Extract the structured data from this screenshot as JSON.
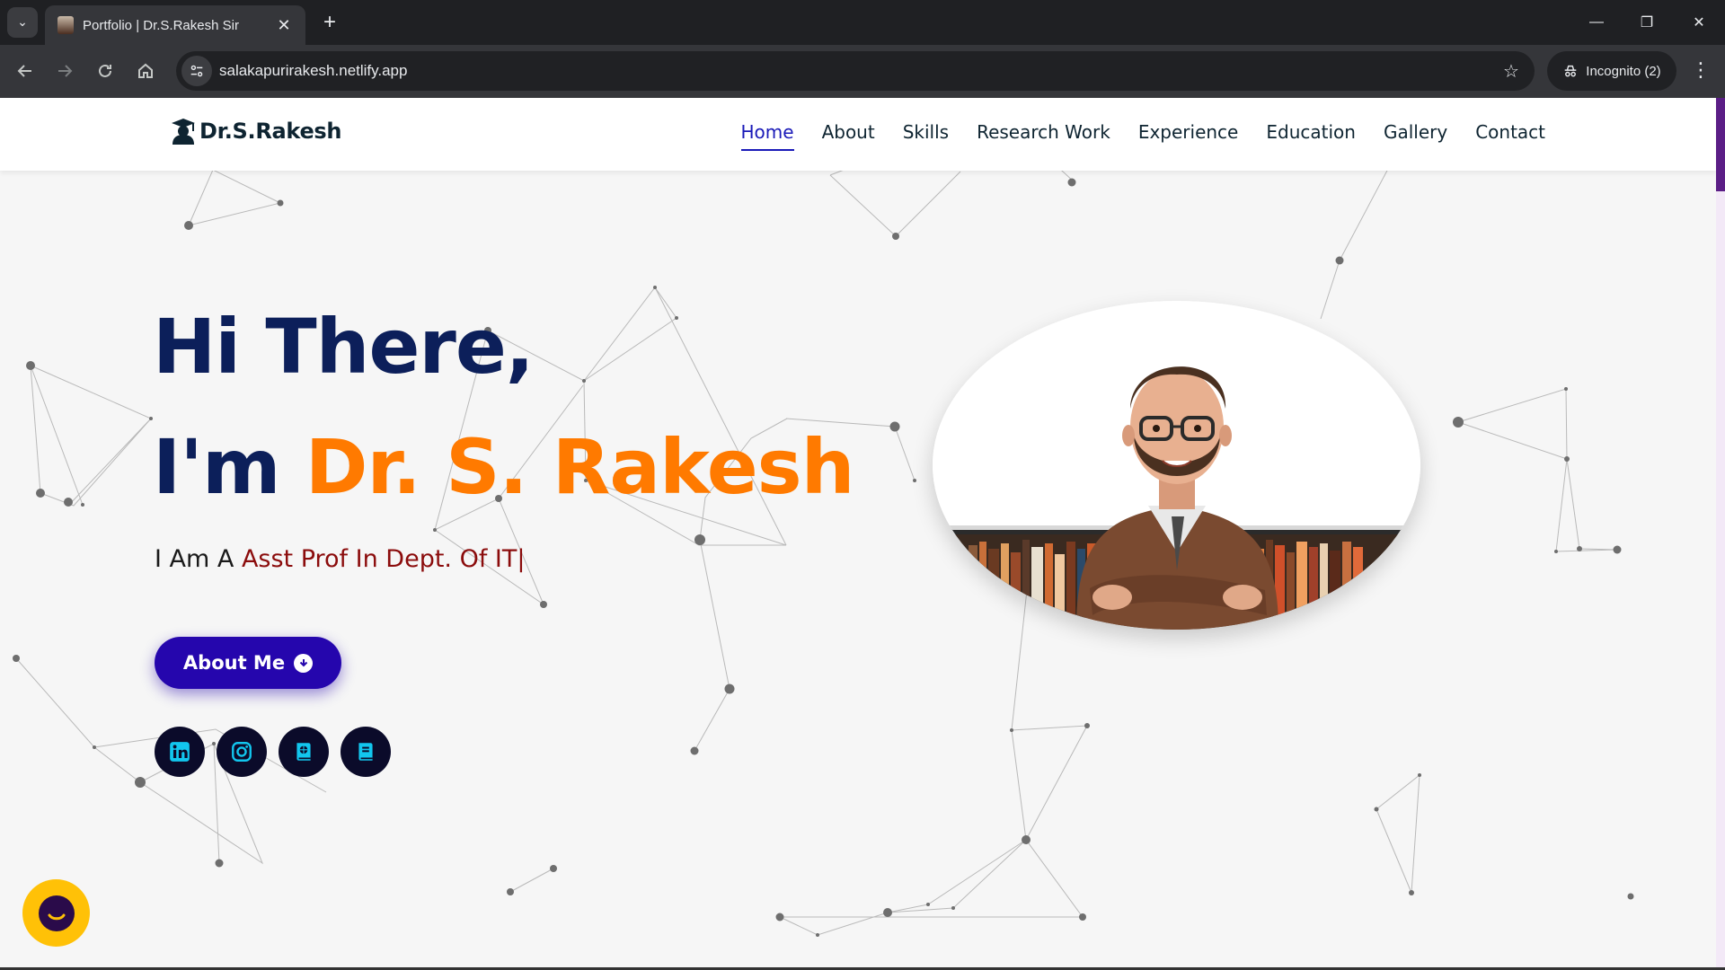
{
  "browser": {
    "tab_title": "Portfolio | Dr.S.Rakesh Sir",
    "url": "salakapurirakesh.netlify.app",
    "incognito_label": "Incognito (2)"
  },
  "header": {
    "logo_text": "Dr.S.Rakesh",
    "nav": [
      {
        "label": "Home",
        "active": true
      },
      {
        "label": "About"
      },
      {
        "label": "Skills"
      },
      {
        "label": "Research Work"
      },
      {
        "label": "Experience"
      },
      {
        "label": "Education"
      },
      {
        "label": "Gallery"
      },
      {
        "label": "Contact"
      }
    ]
  },
  "hero": {
    "line1": "Hi There,",
    "line2_prefix": "I'm ",
    "name": "Dr. S. Rakesh",
    "sub_prefix": "I Am A ",
    "typed_text": "Asst Prof In Dept. Of IT|",
    "button_label": "About Me"
  },
  "socials": [
    "linkedin-icon",
    "instagram-icon",
    "researchgate-icon",
    "google-scholar-icon"
  ],
  "colors": {
    "navy": "#0c1f5a",
    "orange": "#ff7a00",
    "button": "#2506ad",
    "typed": "#8b0c0c",
    "active_nav": "#1a1ab8"
  }
}
